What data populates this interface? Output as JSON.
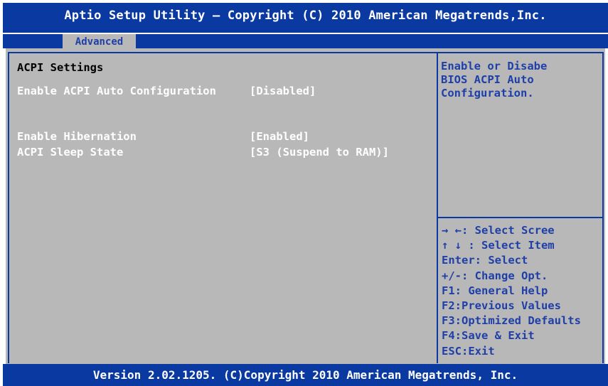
{
  "header": {
    "title": "Aptio Setup Utility – Copyright (C) 2010 American Megatrends,Inc."
  },
  "tabs": [
    {
      "label": "Advanced"
    }
  ],
  "main": {
    "section_title": "ACPI Settings",
    "settings": [
      {
        "label": "Enable ACPI Auto Configuration",
        "value": "[Disabled]"
      },
      {
        "label": "Enable Hibernation",
        "value": "[Enabled]"
      },
      {
        "label": "ACPI Sleep State",
        "value": "[S3 (Suspend to RAM)]"
      }
    ]
  },
  "help": {
    "text_lines": [
      "Enable or Disabe",
      "BIOS ACPI Auto",
      "Configuration."
    ]
  },
  "keys": [
    "→ ←:  Select Scree",
    "↑ ↓ :  Select Item",
    "Enter: Select",
    "+/-:   Change Opt.",
    "F1: General Help",
    "F2:Previous Values",
    "F3:Optimized Defaults",
    "F4:Save & Exit",
    "ESC:Exit"
  ],
  "footer": {
    "text": "Version 2.02.1205. (C)Copyright 2010 American Megatrends, Inc."
  },
  "colors": {
    "bios_blue": "#0a39a2",
    "panel_gray": "#b8b8b8",
    "highlight_white": "#ffffff",
    "help_text": "#1f3fa8"
  }
}
